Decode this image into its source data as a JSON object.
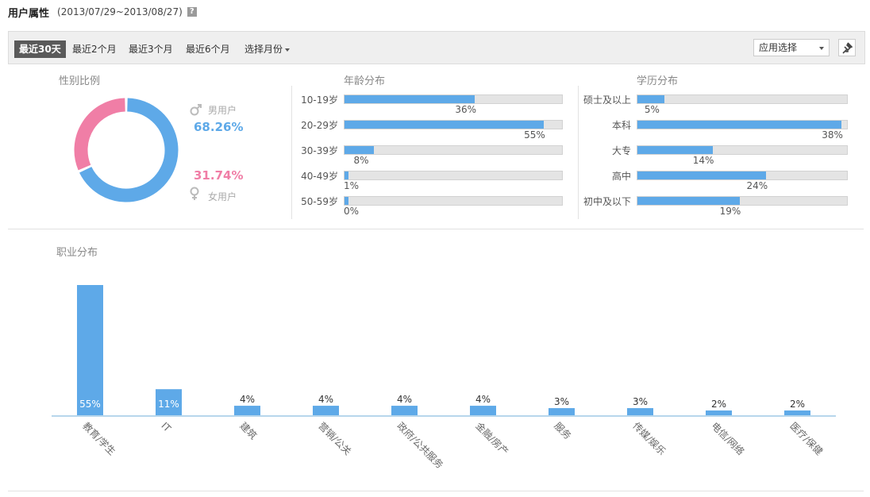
{
  "header": {
    "title": "用户属性",
    "date_range": "(2013/07/29~2013/08/27)",
    "help_glyph": "?"
  },
  "toolbar": {
    "tabs": [
      "最近30天",
      "最近2个月",
      "最近3个月",
      "最近6个月",
      "选择月份"
    ],
    "active_tab": 0,
    "app_select_label": "应用选择"
  },
  "gender": {
    "title": "性别比例",
    "male_label": "男用户",
    "male_pct": "68.26%",
    "female_label": "女用户",
    "female_pct": "31.74%",
    "male_color": "#5ea9e8",
    "female_color": "#f07ea6"
  },
  "age": {
    "title": "年龄分布",
    "rows": [
      {
        "label": "10-19岁",
        "pct": "36%",
        "value": 36
      },
      {
        "label": "20-29岁",
        "pct": "55%",
        "value": 55
      },
      {
        "label": "30-39岁",
        "pct": "8%",
        "value": 8
      },
      {
        "label": "40-49岁",
        "pct": "1%",
        "value": 1
      },
      {
        "label": "50-59岁",
        "pct": "0%",
        "value": 0
      }
    ]
  },
  "education": {
    "title": "学历分布",
    "rows": [
      {
        "label": "硕士及以上",
        "pct": "5%",
        "value": 5
      },
      {
        "label": "本科",
        "pct": "38%",
        "value": 38
      },
      {
        "label": "大专",
        "pct": "14%",
        "value": 14
      },
      {
        "label": "高中",
        "pct": "24%",
        "value": 24
      },
      {
        "label": "初中及以下",
        "pct": "19%",
        "value": 19
      }
    ]
  },
  "occupation": {
    "title": "职业分布"
  },
  "chart_data": [
    {
      "type": "pie",
      "title": "性别比例",
      "categories": [
        "男用户",
        "女用户"
      ],
      "values": [
        68.26,
        31.74
      ]
    },
    {
      "type": "bar",
      "title": "年龄分布",
      "categories": [
        "10-19岁",
        "20-29岁",
        "30-39岁",
        "40-49岁",
        "50-59岁"
      ],
      "values": [
        36,
        55,
        8,
        1,
        0
      ]
    },
    {
      "type": "bar",
      "title": "学历分布",
      "categories": [
        "硕士及以上",
        "本科",
        "大专",
        "高中",
        "初中及以下"
      ],
      "values": [
        5,
        38,
        14,
        24,
        19
      ]
    },
    {
      "type": "bar",
      "title": "职业分布",
      "categories": [
        "教育/学生",
        "IT",
        "建筑",
        "营销/公关",
        "政府/公共服务",
        "金融/房产",
        "服务",
        "传媒/娱乐",
        "电信/网络",
        "医疗/保健"
      ],
      "values": [
        55,
        11,
        4,
        4,
        4,
        4,
        3,
        3,
        2,
        2
      ],
      "value_labels": [
        "55%",
        "11%",
        "4%",
        "4%",
        "4%",
        "4%",
        "3%",
        "3%",
        "2%",
        "2%"
      ],
      "color": "#5ea9e8"
    }
  ]
}
